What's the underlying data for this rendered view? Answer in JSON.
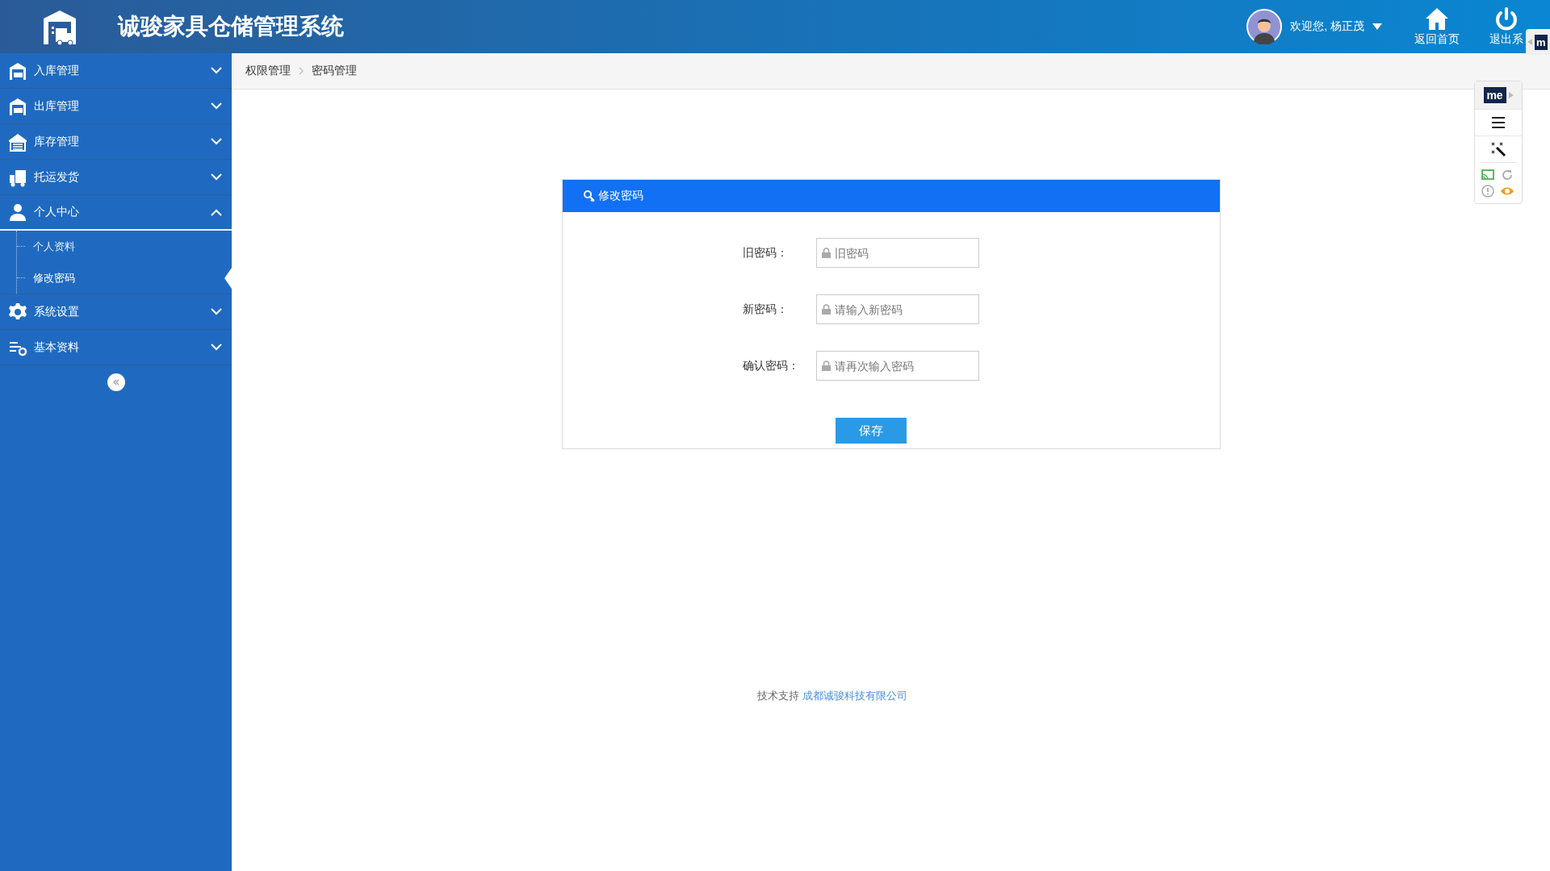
{
  "header": {
    "title": "诚骏家具仓储管理系统",
    "welcome": "欢迎您, 杨正茂",
    "actions": [
      {
        "label": "返回首页"
      },
      {
        "label": "退出系"
      }
    ]
  },
  "sidebar": {
    "items": [
      {
        "label": "入库管理",
        "expanded": false
      },
      {
        "label": "出库管理",
        "expanded": false
      },
      {
        "label": "库存管理",
        "expanded": false
      },
      {
        "label": "托运发货",
        "expanded": false
      },
      {
        "label": "个人中心",
        "expanded": true,
        "children": [
          {
            "label": "个人资料",
            "selected": false
          },
          {
            "label": "修改密码",
            "selected": true
          }
        ]
      },
      {
        "label": "系统设置",
        "expanded": false
      },
      {
        "label": "基本资料",
        "expanded": false
      }
    ]
  },
  "breadcrumb": [
    "权限管理",
    "密码管理"
  ],
  "card": {
    "title": "修改密码",
    "fields": [
      {
        "label": "旧密码：",
        "placeholder": "旧密码"
      },
      {
        "label": "新密码：",
        "placeholder": "请输入新密码"
      },
      {
        "label": "确认密码：",
        "placeholder": "请再次输入密码"
      }
    ],
    "button": "保存"
  },
  "footer": {
    "text": "技术支持",
    "link": "成都诚骏科技有限公司"
  },
  "extension": {
    "logo": "me",
    "edge_tab": "m"
  }
}
